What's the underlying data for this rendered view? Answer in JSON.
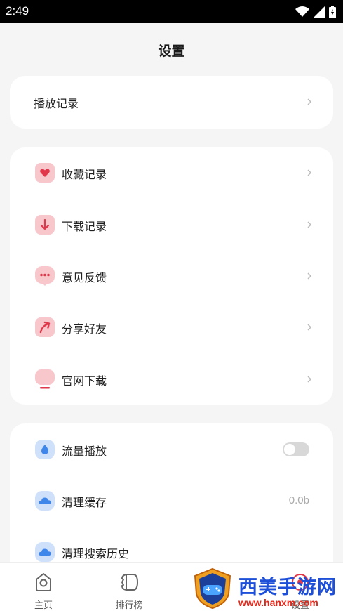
{
  "status_bar": {
    "time": "2:49"
  },
  "page": {
    "title": "设置"
  },
  "section1": {
    "items": [
      {
        "label": "播放记录"
      }
    ]
  },
  "section2": {
    "items": [
      {
        "label": "收藏记录",
        "icon": "heart-icon"
      },
      {
        "label": "下载记录",
        "icon": "download-icon"
      },
      {
        "label": "意见反馈",
        "icon": "chat-bubble-icon"
      },
      {
        "label": "分享好友",
        "icon": "share-arrow-icon"
      },
      {
        "label": "官网下载",
        "icon": "website-icon"
      }
    ]
  },
  "section3": {
    "items": [
      {
        "label": "流量播放",
        "icon": "water-drop-icon",
        "toggle_on": false
      },
      {
        "label": "清理缓存",
        "icon": "cloud-icon",
        "value": "0.0b"
      },
      {
        "label": "清理搜索历史",
        "icon": "cloud-icon"
      }
    ]
  },
  "bottom_nav": {
    "items": [
      {
        "label": "主页",
        "icon": "home-icon"
      },
      {
        "label": "排行榜",
        "icon": "ranking-icon"
      },
      {
        "label": "设置",
        "icon": "settings-icon"
      }
    ]
  },
  "watermark": {
    "text": "西美手游网",
    "url": "www.hanxm.com"
  },
  "colors": {
    "accent_red": "#e0384a",
    "icon_bg_pink": "#f7c7cc",
    "icon_bg_blue": "#cfe0fb",
    "accent_blue": "#3f86ea"
  }
}
